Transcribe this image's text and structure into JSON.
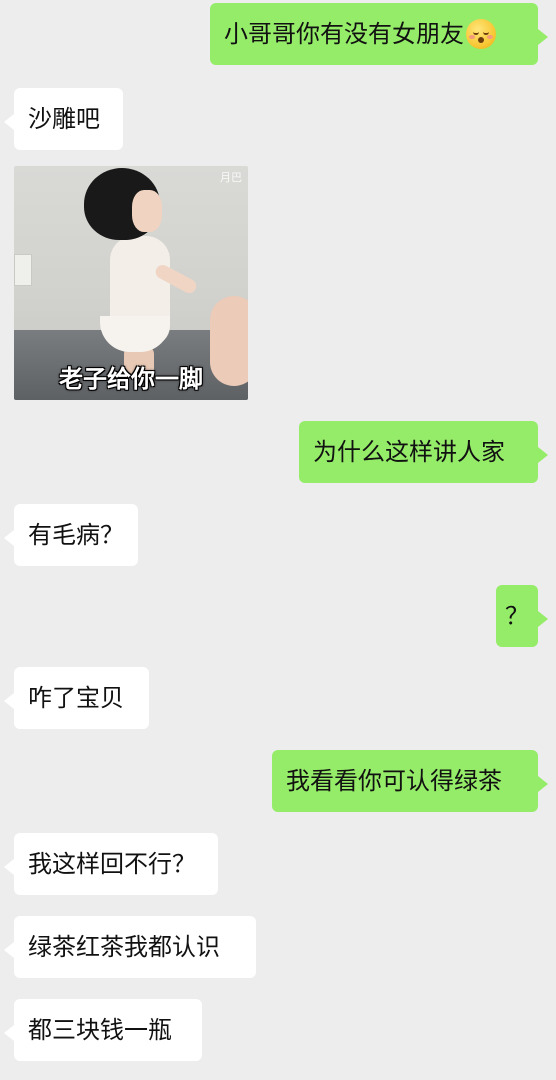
{
  "messages": [
    {
      "id": "m1",
      "side": "right",
      "text": "小哥哥你有没有女朋友",
      "emoji": "blushing-face-icon"
    },
    {
      "id": "m2",
      "side": "left",
      "text": "沙雕吧"
    },
    {
      "id": "m3",
      "side": "left",
      "type": "sticker",
      "watermark": "月巴",
      "caption": "老子给你一脚"
    },
    {
      "id": "m4",
      "side": "right",
      "text": "为什么这样讲人家"
    },
    {
      "id": "m5",
      "side": "left",
      "text": "有毛病？"
    },
    {
      "id": "m6",
      "side": "right",
      "text": "？"
    },
    {
      "id": "m7",
      "side": "left",
      "text": "咋了宝贝"
    },
    {
      "id": "m8",
      "side": "right",
      "text": "我看看你可认得绿茶"
    },
    {
      "id": "m9",
      "side": "left",
      "text": "我这样回不行？"
    },
    {
      "id": "m10",
      "side": "left",
      "text": "绿茶红茶我都认识"
    },
    {
      "id": "m11",
      "side": "left",
      "text": "都三块钱一瓶"
    }
  ],
  "colors": {
    "background": "#ededed",
    "outgoing_bubble": "#95ec69",
    "incoming_bubble": "#ffffff"
  }
}
